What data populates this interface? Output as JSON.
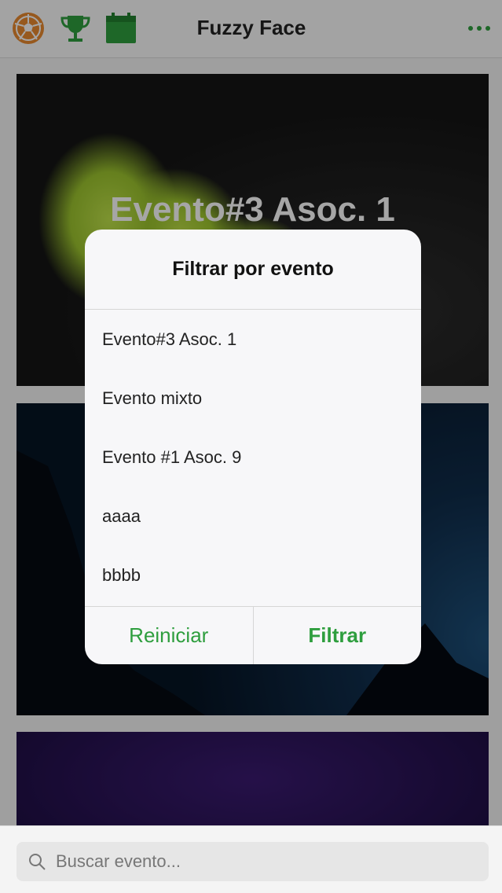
{
  "header": {
    "title": "Fuzzy Face",
    "icons": [
      "soccer-ball-icon",
      "trophy-icon",
      "calendar-icon",
      "more-options-icon"
    ],
    "accent_color": "#2e9e3e",
    "ball_color": "#e8892e"
  },
  "cards": [
    {
      "title": "Evento#3 Asoc. 1"
    },
    {
      "title": ""
    },
    {
      "title": ""
    }
  ],
  "dialog": {
    "title": "Filtrar por evento",
    "options": [
      "Evento#3 Asoc. 1",
      "Evento mixto",
      "Evento #1 Asoc. 9",
      "aaaa",
      "bbbb"
    ],
    "reset_label": "Reiniciar",
    "filter_label": "Filtrar"
  },
  "search": {
    "placeholder": "Buscar evento..."
  }
}
